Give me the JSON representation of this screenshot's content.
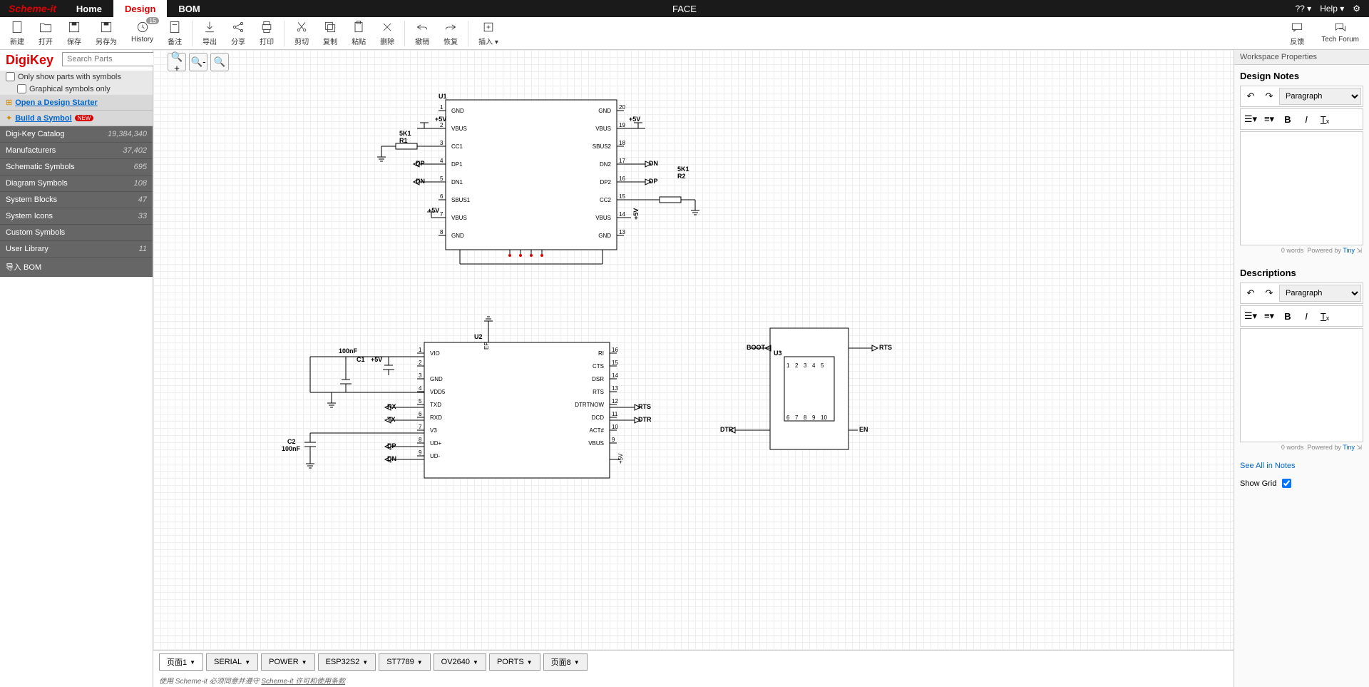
{
  "app": {
    "logo": "Scheme-it",
    "project": "FACE"
  },
  "nav": {
    "home": "Home",
    "design": "Design",
    "bom": "BOM",
    "help": "Help",
    "lang": "??"
  },
  "toolbar": {
    "new": "新建",
    "open": "打开",
    "save": "保存",
    "saveas": "另存为",
    "history": "History",
    "history_badge": "15",
    "notes": "备注",
    "export": "导出",
    "share": "分享",
    "print": "打印",
    "cut": "剪切",
    "copy": "复制",
    "paste": "粘贴",
    "delete": "删除",
    "undo": "撤销",
    "redo": "恢复",
    "insert": "插入",
    "feedback": "反馈",
    "forum": "Tech Forum"
  },
  "sidebar": {
    "brand": "DigiKey",
    "search_placeholder": "Search Parts",
    "only_symbols": "Only show parts with symbols",
    "graphical_only": "Graphical symbols only",
    "design_starter": "Open a Design Starter",
    "build_symbol": "Build a Symbol",
    "new_badge": "NEW",
    "items": [
      {
        "label": "Digi-Key Catalog",
        "count": "19,384,340"
      },
      {
        "label": "Manufacturers",
        "count": "37,402"
      },
      {
        "label": "Schematic Symbols",
        "count": "695"
      },
      {
        "label": "Diagram Symbols",
        "count": "108"
      },
      {
        "label": "System Blocks",
        "count": "47"
      },
      {
        "label": "System Icons",
        "count": "33"
      },
      {
        "label": "Custom Symbols",
        "count": ""
      },
      {
        "label": "User Library",
        "count": "11"
      },
      {
        "label": "导入 BOM",
        "count": ""
      }
    ]
  },
  "pages": [
    "页面1",
    "SERIAL",
    "POWER",
    "ESP32S2",
    "ST7789",
    "OV2640",
    "PORTS",
    "页面8"
  ],
  "footer": {
    "text": "使用 Scheme-it 必须同意并遵守 ",
    "link": "Scheme-it 许可和使用条款"
  },
  "props": {
    "title": "Workspace Properties",
    "design_notes": "Design Notes",
    "descriptions": "Descriptions",
    "paragraph": "Paragraph",
    "words": "0 words",
    "powered": "Powered by",
    "tiny": "Tiny",
    "see_all": "See All in Notes",
    "show_grid": "Show Grid"
  },
  "schematic": {
    "u1": {
      "ref": "U1",
      "r1": "5K1",
      "r1ref": "R1",
      "r2": "5K1",
      "r2ref": "R2",
      "dp": "DP",
      "dn": "DN",
      "v5": "+5V",
      "pins_left": [
        "GND",
        "VBUS",
        "CC1",
        "DP1",
        "DN1",
        "SBUS1",
        "VBUS",
        "GND"
      ],
      "pins_right": [
        "GND",
        "VBUS",
        "SBUS2",
        "DN2",
        "DP2",
        "CC2",
        "VBUS",
        "GND"
      ]
    },
    "u2": {
      "ref": "U2",
      "c1": "100nF",
      "c1ref": "C1",
      "c2": "100nF",
      "c2ref": "C2",
      "v5": "+5V",
      "rx": "RX",
      "tx": "TX",
      "dp": "DP",
      "dn": "DN",
      "rts": "RTS",
      "dtr": "DTR",
      "ep": "EP",
      "pins_left": [
        "VIO",
        "",
        "GND",
        "VDD5",
        "TXD",
        "RXD",
        "V3",
        "UD+",
        "UD-"
      ],
      "pins_right": [
        "RI",
        "CTS",
        "DSR",
        "RTS",
        "DTRTNOW",
        "DCD",
        "ACT#",
        "VBUS"
      ]
    },
    "u3": {
      "ref": "U3",
      "boot": "BOOT",
      "dtr": "DTR",
      "rts": "RTS",
      "en": "EN"
    }
  }
}
